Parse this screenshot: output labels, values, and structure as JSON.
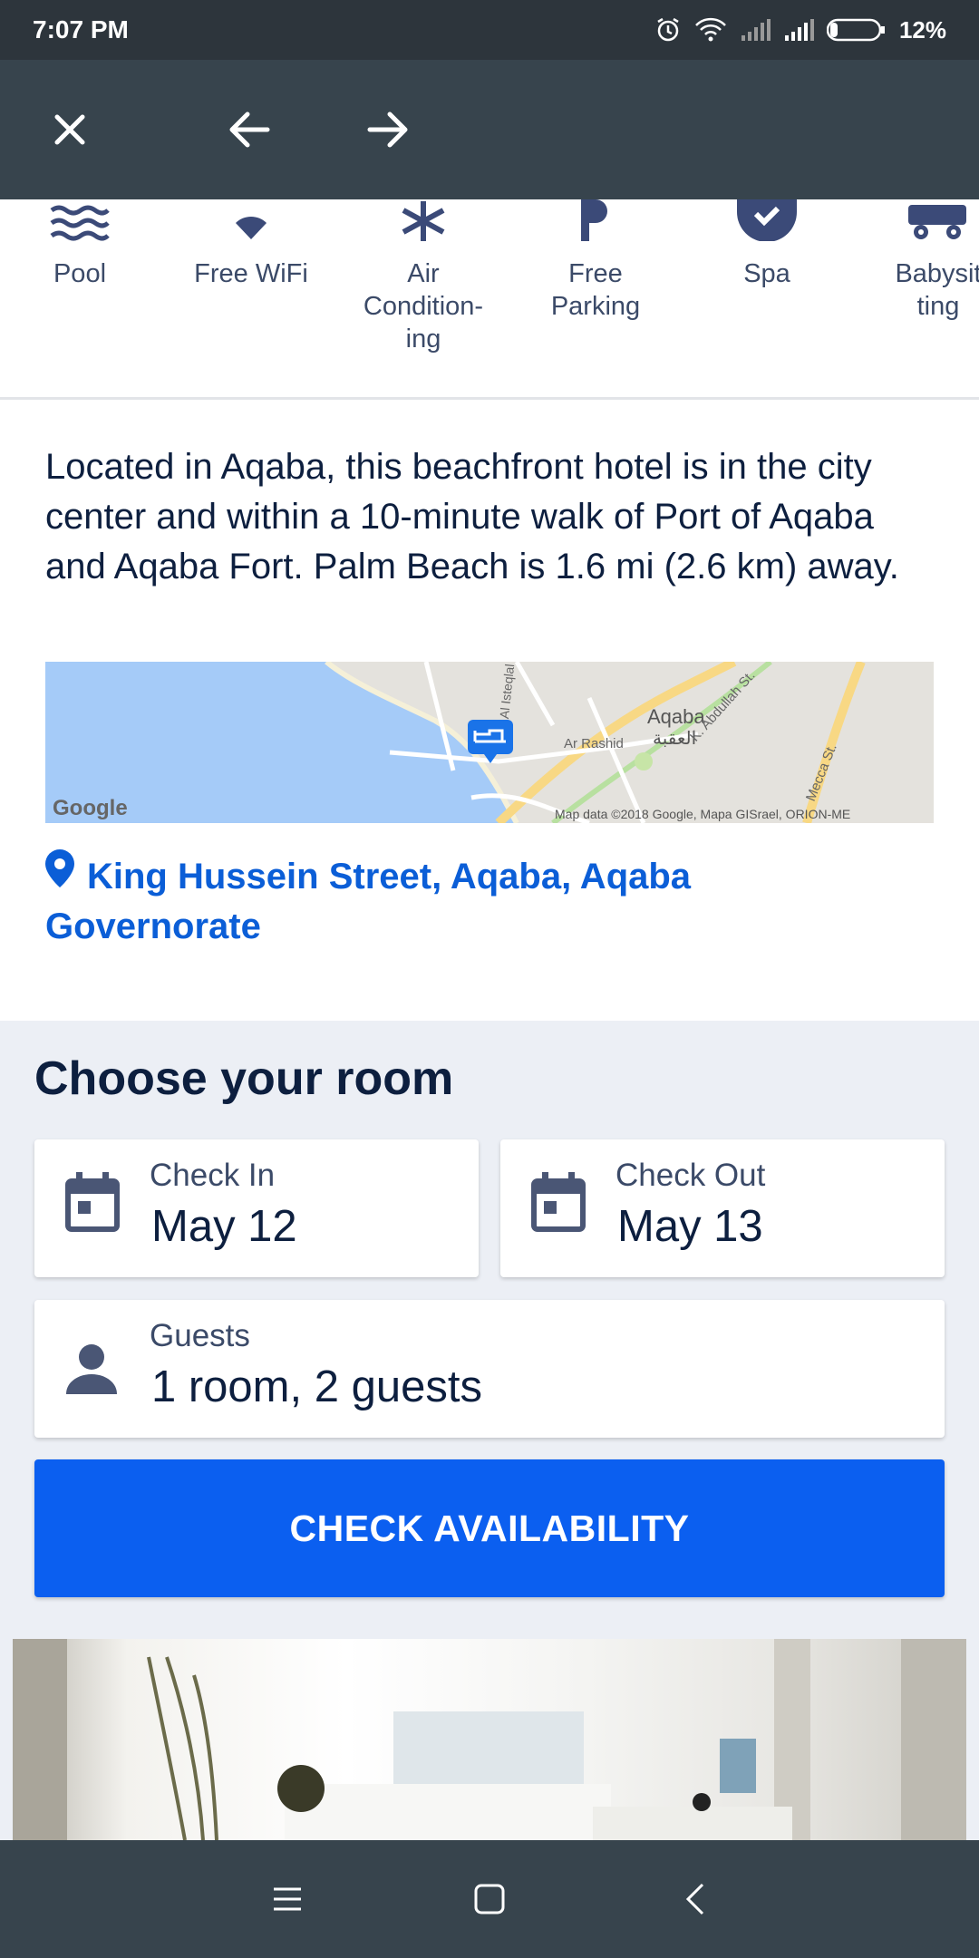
{
  "status_bar": {
    "time": "7:07 PM",
    "battery": "12%"
  },
  "toolbar": {
    "icons": [
      "close-icon",
      "arrow-left-icon",
      "arrow-right-icon"
    ]
  },
  "amenities": [
    {
      "label": "Pool",
      "icon": "pool-icon"
    },
    {
      "label": "Free WiFi",
      "icon": "wifi-icon"
    },
    {
      "label": "Air\nCondition-\ning",
      "icon": "snowflake-icon"
    },
    {
      "label": "Free\nParking",
      "icon": "parking-icon"
    },
    {
      "label": "Spa",
      "icon": "spa-icon"
    },
    {
      "label": "Babysit\nting",
      "icon": "stroller-icon"
    }
  ],
  "description": "Located in Aqaba, this beachfront hotel is in the city center and within a 10-minute walk of Port of Aqaba and Aqaba Fort. Palm Beach is 1.6 mi (2.6 km) away.",
  "map": {
    "city_label": "Aqaba",
    "city_label_ar": "العقبة",
    "street_1": "Ar Rashid",
    "street_2": "K. Abdullah St.",
    "street_3": "Mecca St.",
    "street_4": "Al Isteqlal",
    "logo": "Google",
    "attribution": "Map data ©2018 Google, Mapa GISrael, ORION-ME"
  },
  "address": "King Hussein Street, Aqaba, Aqaba Governorate",
  "booking": {
    "title": "Choose your room",
    "check_in_label": "Check In",
    "check_in_value": "May 12",
    "check_out_label": "Check Out",
    "check_out_value": "May 13",
    "guests_label": "Guests",
    "guests_value": "1 room, 2 guests",
    "button_label": "CHECK AVAILABILITY"
  },
  "colors": {
    "accent": "#0b5ff0",
    "link": "#0b5ed7",
    "toolbar": "#37444d",
    "text": "#0d1f3f"
  }
}
